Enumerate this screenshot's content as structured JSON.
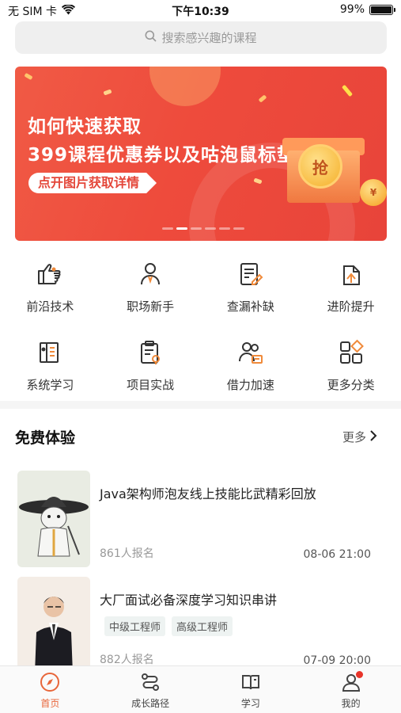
{
  "status_bar": {
    "carrier": "无 SIM 卡",
    "time": "下午10:39",
    "battery": "99%",
    "battery_level": 0.99
  },
  "search": {
    "placeholder": "搜索感兴趣的课程",
    "icon": "search-icon"
  },
  "banner": {
    "line1": "如何快速获取",
    "line2": "399课程优惠券以及咕泡鼠标垫",
    "cta": "点开图片获取详情",
    "coin_text": "抢",
    "coin_small_text": "¥",
    "page_count": 6,
    "active_page": 1
  },
  "categories": [
    {
      "label": "前沿技术",
      "icon": "pointing-hand-icon"
    },
    {
      "label": "职场新手",
      "icon": "person-icon"
    },
    {
      "label": "查漏补缺",
      "icon": "document-edit-icon"
    },
    {
      "label": "进阶提升",
      "icon": "upgrade-icon"
    },
    {
      "label": "系统学习",
      "icon": "book-stack-icon"
    },
    {
      "label": "项目实战",
      "icon": "clipboard-icon"
    },
    {
      "label": "借力加速",
      "icon": "team-icon"
    },
    {
      "label": "更多分类",
      "icon": "grid-icon"
    }
  ],
  "section": {
    "title": "免费体验",
    "more": "更多"
  },
  "courses": [
    {
      "title": "Java架构师泡友线上技能比武精彩回放",
      "count": "861人报名",
      "time": "08-06 21:00",
      "tags": []
    },
    {
      "title": "大厂面试必备深度学习知识串讲",
      "count": "882人报名",
      "time": "07-09 20:00",
      "tags": [
        "中级工程师",
        "高级工程师"
      ]
    }
  ],
  "tabs": [
    {
      "label": "首页",
      "icon": "compass-icon",
      "active": true
    },
    {
      "label": "成长路径",
      "icon": "path-icon",
      "active": false
    },
    {
      "label": "学习",
      "icon": "book-icon",
      "active": false
    },
    {
      "label": "我的",
      "icon": "profile-icon",
      "active": false,
      "badge": true
    }
  ],
  "colors": {
    "accent": "#e8663a",
    "banner_red": "#ee4b3c",
    "badge_red": "#e8342a"
  }
}
